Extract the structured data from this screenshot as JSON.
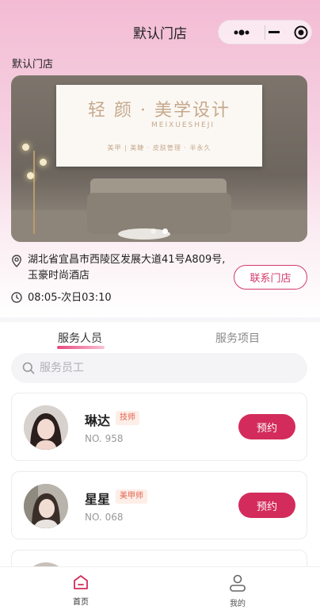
{
  "nav": {
    "title": "默认门店"
  },
  "store": {
    "label": "默认门店",
    "banner": {
      "logo_main": "轻 颜 · 美学设计",
      "logo_sub": "MEIXUESHEJI",
      "logo_tags": "美甲 | 美睫 · 皮肤管理 · 半永久"
    },
    "address": "湖北省宜昌市西陵区发展大道41号A809号,玉豪时尚酒店",
    "hours": "08:05-次日03:10",
    "contact_label": "联系门店"
  },
  "tabs": [
    {
      "label": "服务人员",
      "active": true
    },
    {
      "label": "服务项目",
      "active": false
    }
  ],
  "search": {
    "placeholder": "服务员工",
    "value": ""
  },
  "staff": [
    {
      "name": "琳达",
      "tag": "技师",
      "no": "NO. 958",
      "book_label": "预约"
    },
    {
      "name": "星星",
      "tag": "美甲师",
      "no": "NO. 068",
      "book_label": "预约"
    }
  ],
  "tabbar": [
    {
      "label": "首页",
      "icon": "home-icon",
      "active": true
    },
    {
      "label": "我的",
      "icon": "user-icon",
      "active": false
    }
  ],
  "colors": {
    "accent": "#d32c5c",
    "tag_text": "#e2614c",
    "header_pink": "#f3bcd4"
  }
}
